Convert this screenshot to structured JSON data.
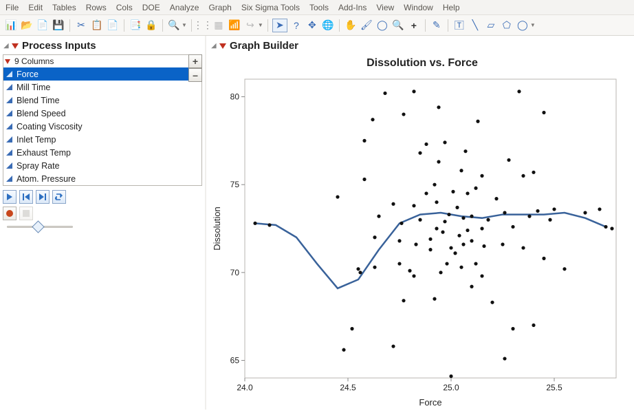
{
  "menu": [
    "File",
    "Edit",
    "Tables",
    "Rows",
    "Cols",
    "DOE",
    "Analyze",
    "Graph",
    "Six Sigma Tools",
    "Tools",
    "Add-Ins",
    "View",
    "Window",
    "Help"
  ],
  "left_panel": {
    "title": "Process Inputs",
    "subtitle": "9 Columns",
    "columns": [
      "Force",
      "Mill Time",
      "Blend Time",
      "Blend Speed",
      "Coating Viscosity",
      "Inlet Temp",
      "Exhaust Temp",
      "Spray Rate",
      "Atom. Pressure"
    ],
    "selected_index": 0,
    "plus_label": "+",
    "minus_label": "–"
  },
  "right_panel": {
    "title": "Graph Builder"
  },
  "chart_data": {
    "type": "scatter",
    "title": "Dissolution vs. Force",
    "xlabel": "Force",
    "ylabel": "Dissolution",
    "xlim": [
      24.0,
      25.8
    ],
    "ylim": [
      64,
      81
    ],
    "x_ticks": [
      24.0,
      24.5,
      25.0,
      25.5
    ],
    "y_ticks": [
      65,
      70,
      75,
      80
    ],
    "smooth_line": {
      "x": [
        24.05,
        24.15,
        24.25,
        24.35,
        24.45,
        24.55,
        24.65,
        24.75,
        24.85,
        24.95,
        25.05,
        25.15,
        25.25,
        25.35,
        25.45,
        25.55,
        25.65,
        25.75
      ],
      "y": [
        72.8,
        72.7,
        72.0,
        70.5,
        69.1,
        69.6,
        71.3,
        72.8,
        73.3,
        73.4,
        73.2,
        73.1,
        73.3,
        73.3,
        73.3,
        73.4,
        73.1,
        72.6
      ]
    },
    "series": [
      {
        "name": "points",
        "x": [
          24.05,
          24.12,
          24.45,
          24.48,
          24.52,
          24.55,
          24.56,
          24.58,
          24.58,
          24.62,
          24.63,
          24.63,
          24.65,
          24.68,
          24.72,
          24.72,
          24.75,
          24.75,
          24.76,
          24.77,
          24.77,
          24.8,
          24.82,
          24.82,
          24.82,
          24.83,
          24.85,
          24.85,
          24.88,
          24.88,
          24.9,
          24.9,
          24.92,
          24.92,
          24.93,
          24.93,
          24.94,
          24.94,
          24.95,
          24.96,
          24.97,
          24.97,
          24.98,
          24.99,
          25.0,
          25.0,
          25.01,
          25.02,
          25.03,
          25.04,
          25.05,
          25.05,
          25.06,
          25.06,
          25.07,
          25.08,
          25.08,
          25.1,
          25.1,
          25.1,
          25.12,
          25.12,
          25.13,
          25.15,
          25.15,
          25.15,
          25.16,
          25.18,
          25.2,
          25.22,
          25.25,
          25.26,
          25.26,
          25.28,
          25.3,
          25.3,
          25.33,
          25.35,
          25.35,
          25.38,
          25.4,
          25.4,
          25.42,
          25.45,
          25.45,
          25.48,
          25.5,
          25.55,
          25.65,
          25.72,
          25.75,
          25.78
        ],
        "y": [
          72.8,
          72.7,
          74.3,
          65.6,
          66.8,
          70.2,
          70.0,
          75.3,
          77.5,
          78.7,
          70.3,
          72.0,
          73.2,
          80.2,
          65.8,
          73.9,
          70.5,
          71.8,
          72.8,
          68.4,
          79.0,
          70.1,
          69.8,
          80.3,
          73.8,
          71.6,
          73.0,
          76.8,
          74.5,
          77.3,
          71.3,
          71.9,
          68.5,
          75.0,
          72.5,
          74.0,
          76.3,
          79.4,
          70.0,
          72.3,
          72.9,
          77.4,
          70.5,
          73.3,
          71.4,
          64.1,
          74.6,
          71.1,
          73.7,
          72.1,
          75.8,
          70.3,
          71.6,
          73.1,
          76.9,
          72.4,
          74.5,
          69.2,
          71.8,
          73.2,
          74.8,
          70.5,
          78.6,
          72.5,
          69.8,
          75.5,
          71.5,
          73.0,
          68.3,
          74.2,
          71.6,
          73.4,
          65.1,
          76.4,
          66.8,
          72.6,
          80.3,
          71.4,
          75.5,
          73.2,
          75.7,
          67.0,
          73.5,
          79.1,
          70.8,
          73.0,
          73.6,
          70.2,
          73.4,
          73.6,
          72.6,
          72.5
        ]
      }
    ]
  }
}
